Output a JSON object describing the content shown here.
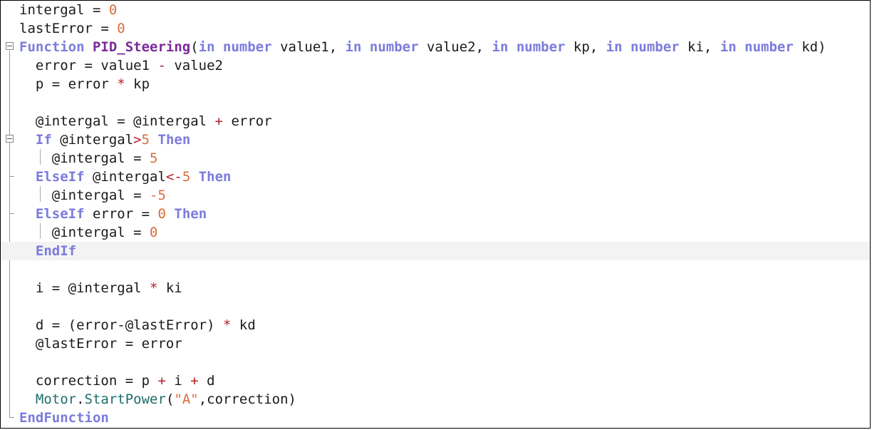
{
  "editor": {
    "lines": [
      {
        "tokens": [
          {
            "t": "intergal = ",
            "c": ""
          },
          {
            "t": "0",
            "c": "num"
          }
        ]
      },
      {
        "tokens": [
          {
            "t": "lastError = ",
            "c": ""
          },
          {
            "t": "0",
            "c": "num"
          }
        ]
      },
      {
        "tokens": [
          {
            "t": "Function ",
            "c": "kw"
          },
          {
            "t": "PID_Steering",
            "c": "fn"
          },
          {
            "t": "(",
            "c": ""
          },
          {
            "t": "in number",
            "c": "kw"
          },
          {
            "t": " value1, ",
            "c": ""
          },
          {
            "t": "in number",
            "c": "kw"
          },
          {
            "t": " value2, ",
            "c": ""
          },
          {
            "t": "in number",
            "c": "kw"
          },
          {
            "t": " kp, ",
            "c": ""
          },
          {
            "t": "in number",
            "c": "kw"
          },
          {
            "t": " ki, ",
            "c": ""
          },
          {
            "t": "in number",
            "c": "kw"
          },
          {
            "t": " kd)",
            "c": ""
          }
        ]
      },
      {
        "tokens": [
          {
            "t": "  error = value1 ",
            "c": ""
          },
          {
            "t": "-",
            "c": "op"
          },
          {
            "t": " value2",
            "c": ""
          }
        ]
      },
      {
        "tokens": [
          {
            "t": "  p = error ",
            "c": ""
          },
          {
            "t": "*",
            "c": "op"
          },
          {
            "t": " kp",
            "c": ""
          }
        ]
      },
      {
        "tokens": [
          {
            "t": "",
            "c": ""
          }
        ]
      },
      {
        "tokens": [
          {
            "t": "  @intergal = @intergal ",
            "c": ""
          },
          {
            "t": "+",
            "c": "op"
          },
          {
            "t": " error",
            "c": ""
          }
        ]
      },
      {
        "tokens": [
          {
            "t": "  ",
            "c": ""
          },
          {
            "t": "If",
            "c": "kw"
          },
          {
            "t": " @intergal",
            "c": ""
          },
          {
            "t": ">",
            "c": "op"
          },
          {
            "t": "5",
            "c": "num"
          },
          {
            "t": " ",
            "c": ""
          },
          {
            "t": "Then",
            "c": "kw"
          }
        ]
      },
      {
        "tokens": [
          {
            "t": "    @intergal = ",
            "c": ""
          },
          {
            "t": "5",
            "c": "num"
          }
        ]
      },
      {
        "tokens": [
          {
            "t": "  ",
            "c": ""
          },
          {
            "t": "ElseIf",
            "c": "kw"
          },
          {
            "t": " @intergal",
            "c": ""
          },
          {
            "t": "<-",
            "c": "op"
          },
          {
            "t": "5",
            "c": "num"
          },
          {
            "t": " ",
            "c": ""
          },
          {
            "t": "Then",
            "c": "kw"
          }
        ]
      },
      {
        "tokens": [
          {
            "t": "    @intergal = ",
            "c": ""
          },
          {
            "t": "-5",
            "c": "num"
          }
        ]
      },
      {
        "tokens": [
          {
            "t": "  ",
            "c": ""
          },
          {
            "t": "ElseIf",
            "c": "kw"
          },
          {
            "t": " error = ",
            "c": ""
          },
          {
            "t": "0",
            "c": "num"
          },
          {
            "t": " ",
            "c": ""
          },
          {
            "t": "Then",
            "c": "kw"
          }
        ]
      },
      {
        "tokens": [
          {
            "t": "    @intergal = ",
            "c": ""
          },
          {
            "t": "0",
            "c": "num"
          }
        ]
      },
      {
        "tokens": [
          {
            "t": "  ",
            "c": ""
          },
          {
            "t": "EndIf",
            "c": "kw"
          }
        ],
        "highlight": true
      },
      {
        "tokens": [
          {
            "t": "",
            "c": ""
          }
        ]
      },
      {
        "tokens": [
          {
            "t": "  i = @intergal ",
            "c": ""
          },
          {
            "t": "*",
            "c": "op"
          },
          {
            "t": " ki",
            "c": ""
          }
        ]
      },
      {
        "tokens": [
          {
            "t": "",
            "c": ""
          }
        ]
      },
      {
        "tokens": [
          {
            "t": "  d = (error-@lastError) ",
            "c": ""
          },
          {
            "t": "*",
            "c": "op"
          },
          {
            "t": " kd",
            "c": ""
          }
        ]
      },
      {
        "tokens": [
          {
            "t": "  @lastError = error",
            "c": ""
          }
        ]
      },
      {
        "tokens": [
          {
            "t": "",
            "c": ""
          }
        ]
      },
      {
        "tokens": [
          {
            "t": "  correction = p ",
            "c": ""
          },
          {
            "t": "+",
            "c": "op"
          },
          {
            "t": " i ",
            "c": ""
          },
          {
            "t": "+",
            "c": "op"
          },
          {
            "t": " d",
            "c": ""
          }
        ]
      },
      {
        "tokens": [
          {
            "t": "  ",
            "c": ""
          },
          {
            "t": "Motor",
            "c": "obj"
          },
          {
            "t": ".",
            "c": ""
          },
          {
            "t": "StartPower",
            "c": "obj"
          },
          {
            "t": "(",
            "c": ""
          },
          {
            "t": "\"A\"",
            "c": "str"
          },
          {
            "t": ",correction)",
            "c": ""
          }
        ]
      },
      {
        "tokens": [
          {
            "t": "EndFunction",
            "c": "kw"
          }
        ]
      }
    ]
  }
}
